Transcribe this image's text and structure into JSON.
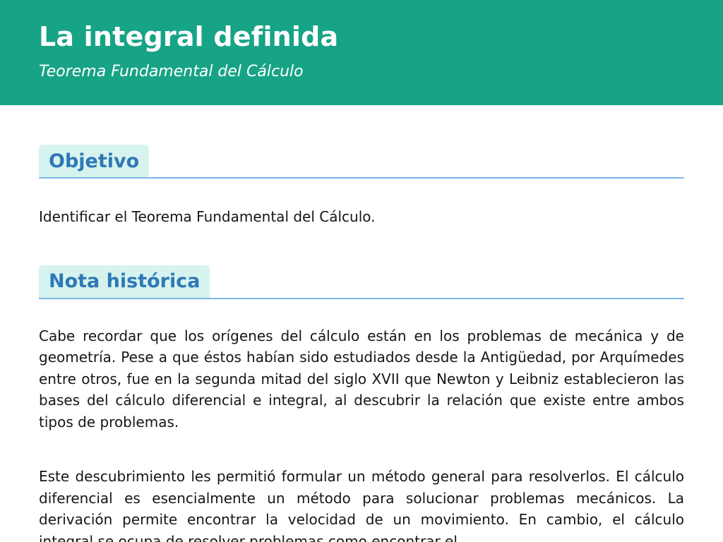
{
  "header": {
    "title": "La integral definida",
    "subtitle": "Teorema Fundamental del Cálculo"
  },
  "sections": [
    {
      "heading": "Objetivo",
      "paragraphs": [
        "Identificar el Teorema Fundamental del Cálculo."
      ]
    },
    {
      "heading": "Nota histórica",
      "paragraphs": [
        "Cabe recordar que los orígenes del cálculo están en los problemas de mecánica y de geometría. Pese a que éstos habían sido estudiados desde la Antigüedad, por Arquímedes entre otros, fue en la segunda mitad del siglo XVII que Newton y Leibniz establecieron las bases del cálculo diferencial e integral, al descubrir la relación que existe entre ambos tipos de problemas.",
        "Este descubrimiento les permitió formular un método general para resolverlos. El cálculo diferencial es esencialmente un método para solucionar problemas mecánicos. La derivación permite encontrar la velocidad de un movimiento. En cambio, el cálculo integral se ocupa de resolver problemas como encontrar el"
      ]
    }
  ],
  "colors": {
    "header_bg": "#17a386",
    "heading_tab_bg": "#d7f3ef",
    "heading_text": "#2e78b6",
    "heading_rule": "#7bb8f0"
  }
}
